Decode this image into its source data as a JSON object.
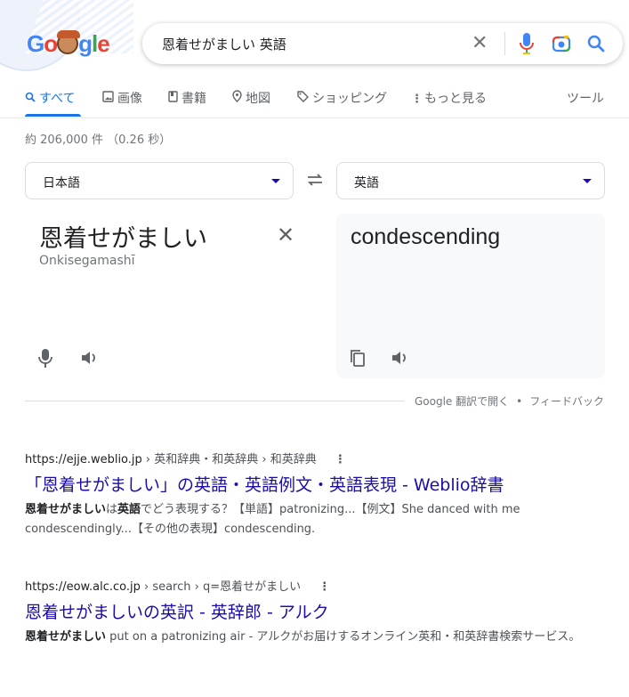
{
  "logo": {
    "letters": [
      "G",
      "o",
      "",
      "g",
      "l",
      "e"
    ]
  },
  "search": {
    "query": "恩着せがましい 英語",
    "clear_label": "✕"
  },
  "tabs": [
    {
      "label": "すべて",
      "icon": "search-icon",
      "active": true
    },
    {
      "label": "画像",
      "icon": "image-icon"
    },
    {
      "label": "書籍",
      "icon": "book-icon"
    },
    {
      "label": "地図",
      "icon": "map-pin-icon"
    },
    {
      "label": "ショッピング",
      "icon": "tag-icon"
    },
    {
      "label": "もっと見る",
      "icon": "more-vert-icon"
    },
    {
      "label": "ツール"
    }
  ],
  "stats": "約 206,000 件 （0.26 秒）",
  "translate": {
    "source_lang": "日本語",
    "target_lang": "英語",
    "source_text": "恩着せがましい",
    "source_translit": "Onkisegamashī",
    "target_text": "condescending",
    "footer_open": "Google 翻訳で開く",
    "footer_sep": "•",
    "footer_feedback": "フィードバック"
  },
  "results": [
    {
      "url": "https://ejje.weblio.jp",
      "path": " › 英和辞典・和英辞典 › 和英辞典",
      "title": "「恩着せがましい」の英語・英語例文・英語表現 - Weblio辞書",
      "snippet_bold": "恩着せがましい",
      "snippet_mid": "は",
      "snippet_bold2": "英語",
      "snippet_rest": "でどう表現する？【単語】patronizing...【例文】She danced with me condescendingly...【その他の表現】condescending."
    },
    {
      "url": "https://eow.alc.co.jp",
      "path": " › search › q=恩着せがましい",
      "title": "恩着せがましいの英訳 - 英辞郎 - アルク",
      "snippet_bold": "恩着せがましい",
      "snippet_rest": " put on a patronizing air - アルクがお届けするオンライン英和・和英辞書検索サービス。"
    }
  ],
  "colors": {
    "link": "#1a0dab",
    "accent": "#1a73e8",
    "muted": "#70757a"
  }
}
